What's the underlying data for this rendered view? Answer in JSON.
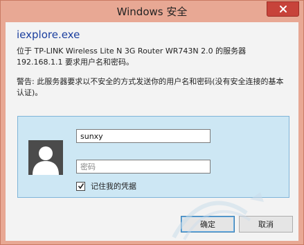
{
  "window": {
    "title": "Windows 安全"
  },
  "dialog": {
    "app_name": "iexplore.exe",
    "description_line1": "位于 TP-LINK Wireless Lite N 3G Router WR743N 2.0 的服务器",
    "description_line2": "192.168.1.1 要求用户名和密码。",
    "warning": "警告: 此服务器要求以不安全的方式发送你的用户名和密码(没有安全连接的基本认证)。"
  },
  "credentials": {
    "username_value": "sunxy",
    "password_placeholder": "密码",
    "remember_label": "记住我的凭据",
    "remember_checked": true
  },
  "buttons": {
    "ok_label": "确定",
    "cancel_label": "取消"
  },
  "colors": {
    "frame": "#e8a894",
    "panel": "#cde7f4",
    "app_name": "#1a3e9e",
    "close": "#c7433a"
  },
  "icons": {
    "avatar": "user-avatar-icon",
    "close": "close-icon",
    "check": "checkmark-icon"
  }
}
